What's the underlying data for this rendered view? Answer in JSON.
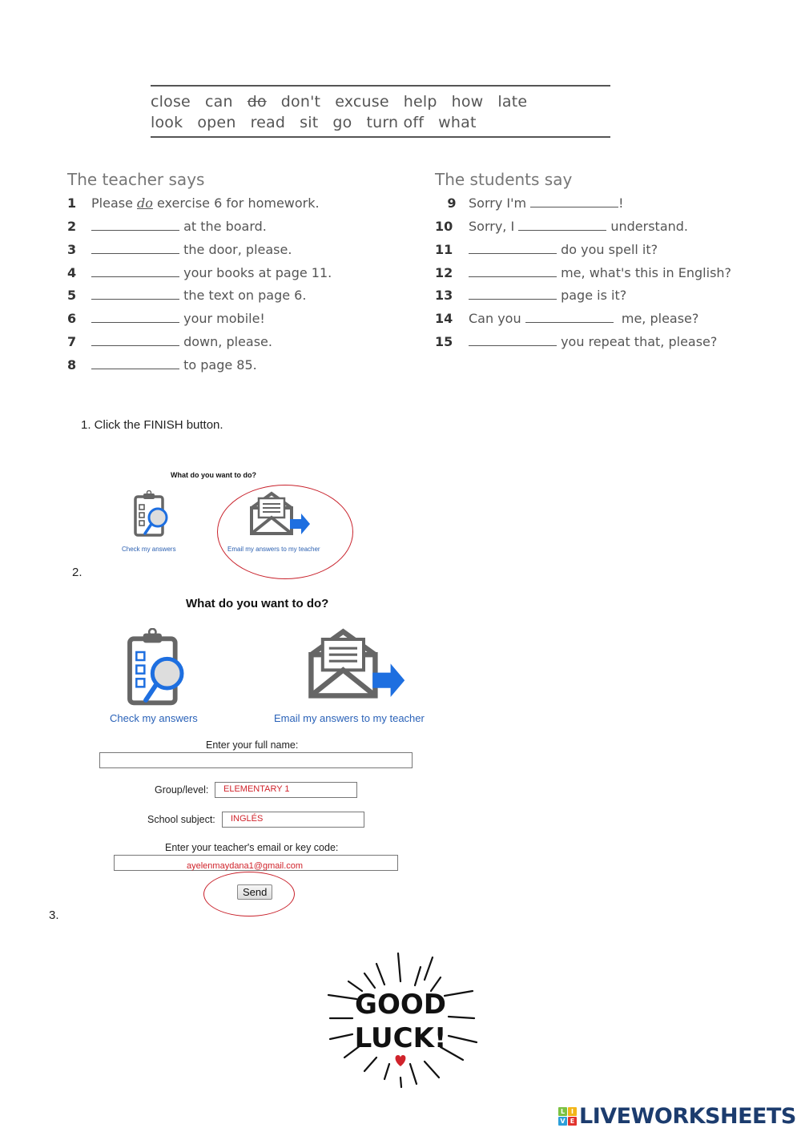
{
  "word_box": {
    "row1": [
      "close",
      "can",
      "do",
      "don't",
      "excuse",
      "help",
      "how",
      "late"
    ],
    "row2": [
      "look",
      "open",
      "read",
      "sit",
      "go",
      "turn off",
      "what"
    ],
    "struck_word": "do"
  },
  "teacher": {
    "title": "The teacher says",
    "items": [
      {
        "num": "1",
        "before": "Please ",
        "example": "do",
        "after": " exercise 6 for homework."
      },
      {
        "num": "2",
        "before": "",
        "after": "at the board."
      },
      {
        "num": "3",
        "before": "",
        "after": "the door, please."
      },
      {
        "num": "4",
        "before": "",
        "after": "your books at page 11."
      },
      {
        "num": "5",
        "before": "",
        "after": "the text on page 6."
      },
      {
        "num": "6",
        "before": "",
        "after": "your mobile!"
      },
      {
        "num": "7",
        "before": "",
        "after": "down, please."
      },
      {
        "num": "8",
        "before": "",
        "after": "to page 85."
      }
    ]
  },
  "students": {
    "title": "The students say",
    "items": [
      {
        "num": "9",
        "before": "Sorry I'm ",
        "after": "!"
      },
      {
        "num": "10",
        "before": "Sorry, I ",
        "after": " understand."
      },
      {
        "num": "11",
        "before": "",
        "after": " do you spell it?"
      },
      {
        "num": "12",
        "before": "",
        "after": " me, what's this in English?"
      },
      {
        "num": "13",
        "before": "",
        "after": " page is it?"
      },
      {
        "num": "14",
        "before": "Can you ",
        "after": "  me, please?"
      },
      {
        "num": "15",
        "before": "",
        "after": " you repeat that, please?"
      }
    ]
  },
  "instructions": {
    "step1": "1. Click the FINISH button.",
    "step2": "2.",
    "step3": "3."
  },
  "finish_small": {
    "title": "What do you want to do?",
    "check_label": "Check my answers",
    "email_label": "Email my answers to my teacher"
  },
  "finish_large": {
    "title": "What do you want to do?",
    "check_label": "Check my answers",
    "email_label": "Email my answers to my teacher",
    "form": {
      "name_label": "Enter your full name:",
      "name_value": "",
      "group_label": "Group/level:",
      "group_value": "ELEMENTARY 1",
      "subject_label": "School subject:",
      "subject_value": "INGLÉS",
      "email_label": "Enter your teacher's email or key code:",
      "email_value": "ayelenmaydana1@gmail.com",
      "send_label": "Send"
    }
  },
  "good_luck": {
    "line1": "GOOD",
    "line2": "LUCK!"
  },
  "brand": {
    "name": "LIVEWORKSHEETS",
    "blocks": [
      "L",
      "I",
      "V",
      "E"
    ],
    "colors": {
      "accent_red": "#c8202a",
      "link_blue": "#2a62b8",
      "brand_navy": "#1c3c6e"
    }
  }
}
